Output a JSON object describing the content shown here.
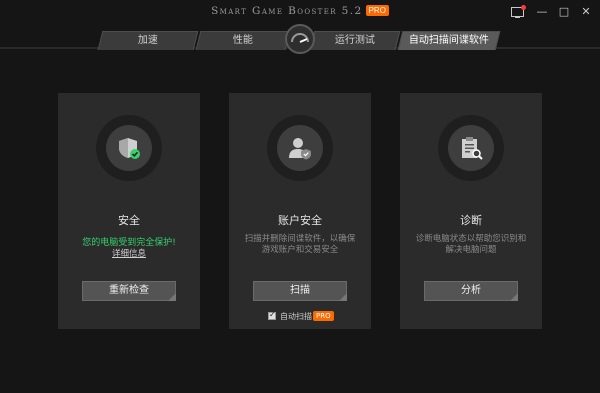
{
  "app": {
    "title": "Smart Game Booster 5.2",
    "badge": "PRO"
  },
  "tabs": [
    "加速",
    "性能",
    "运行测试",
    "自动扫描间谍软件"
  ],
  "cards": {
    "security": {
      "title": "安全",
      "status": "您的电脑受到完全保护!",
      "link": "详细信息",
      "button": "重新检查",
      "status_color": "#36d16c"
    },
    "account": {
      "title": "账户安全",
      "desc": "扫描并删除间谍软件，以确保游戏账户和交易安全",
      "button": "扫描"
    },
    "diagnose": {
      "title": "诊断",
      "desc": "诊断电脑状态以帮助您识别和解决电脑问题",
      "button": "分析"
    }
  },
  "auto_scan": {
    "label": "自动扫描",
    "badge": "PRO",
    "checked": true
  },
  "colors": {
    "accent": "#ff6a00",
    "background": "#151515",
    "card": "#2b2b2b"
  },
  "icons": [
    "monitor-icon",
    "minimize-icon",
    "maximize-icon",
    "close-icon",
    "gauge-icon",
    "shield-check-icon",
    "user-shield-icon",
    "clipboard-search-icon"
  ]
}
